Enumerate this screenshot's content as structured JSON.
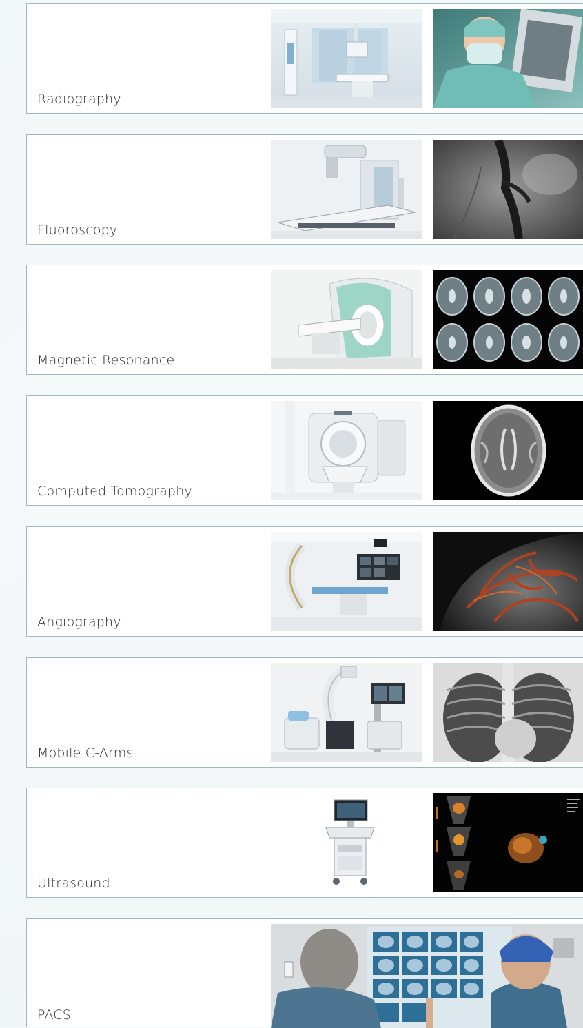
{
  "rows": [
    {
      "label": "Radiography",
      "equipment_icon": "xray-room-icon",
      "image_icon": "doctor-xray-film-icon"
    },
    {
      "label": "Fluoroscopy",
      "equipment_icon": "fluoroscopy-system-icon",
      "image_icon": "fluoroscopy-scan-icon"
    },
    {
      "label": "Magnetic Resonance",
      "equipment_icon": "mri-scanner-icon",
      "image_icon": "mri-brain-slices-icon"
    },
    {
      "label": "Computed Tomography",
      "equipment_icon": "ct-scanner-icon",
      "image_icon": "ct-brain-scan-icon"
    },
    {
      "label": "Angiography",
      "equipment_icon": "angiography-system-icon",
      "image_icon": "angiography-vessels-icon"
    },
    {
      "label": "Mobile C-Arms",
      "equipment_icon": "mobile-c-arm-icon",
      "image_icon": "chest-xray-icon"
    },
    {
      "label": "Ultrasound",
      "equipment_icon": "ultrasound-cart-icon",
      "image_icon": "ultrasound-screen-icon"
    },
    {
      "label": "PACS",
      "equipment_icon": "pacs-reading-room-icon"
    }
  ],
  "colors": {
    "border": "#9bb8bd",
    "text": "#2c2c2c",
    "background": "#f3f8f9"
  }
}
